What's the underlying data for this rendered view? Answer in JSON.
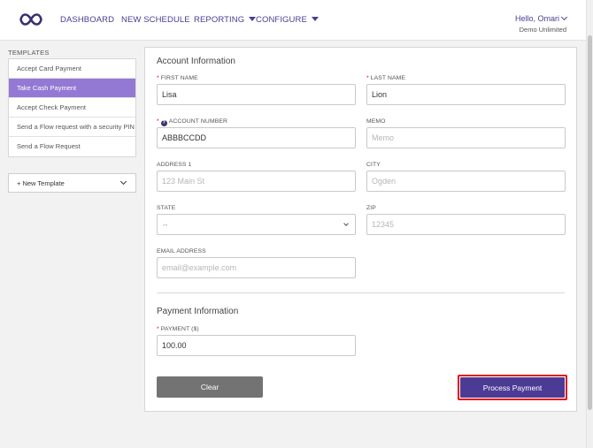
{
  "nav": {
    "items": [
      {
        "label": "DASHBOARD"
      },
      {
        "label": "NEW SCHEDULE"
      },
      {
        "label": "REPORTING"
      },
      {
        "label": "CONFIGURE"
      }
    ],
    "user_greeting": "Hello, Omari",
    "organization": "Demo Unlimited",
    "logo_icon": "infinity-logo-icon",
    "brand_color": "#4a3d8f"
  },
  "sidebar": {
    "heading": "TEMPLATES",
    "items": [
      {
        "label": "Accept Card Payment",
        "active": false
      },
      {
        "label": "Take Cash Payment",
        "active": true
      },
      {
        "label": "Accept Check Payment",
        "active": false
      },
      {
        "label": "Send a Flow request with a security PIN",
        "active": false
      },
      {
        "label": "Send a Flow Request",
        "active": false
      }
    ],
    "new_template_label": "+ New Template",
    "active_color": "#9479d4"
  },
  "form": {
    "account_section_title": "Account Information",
    "first_name": {
      "label": "FIRST NAME",
      "value": "Lisa",
      "required": true
    },
    "last_name": {
      "label": "LAST NAME",
      "value": "Lion",
      "required": true
    },
    "account_number": {
      "label": "ACCOUNT NUMBER",
      "value": "ABBBCCDD",
      "required": true
    },
    "memo": {
      "label": "MEMO",
      "value": "",
      "placeholder": "Memo"
    },
    "address1": {
      "label": "ADDRESS 1",
      "value": "",
      "placeholder": "123 Main St"
    },
    "city": {
      "label": "CITY",
      "value": "",
      "placeholder": "Ogden"
    },
    "state": {
      "label": "STATE",
      "selected": "--"
    },
    "zip": {
      "label": "ZIP",
      "value": "",
      "placeholder": "12345"
    },
    "email": {
      "label": "EMAIL ADDRESS",
      "value": "",
      "placeholder": "email@example.com"
    },
    "payment_section_title": "Payment Information",
    "payment": {
      "label": "PAYMENT ($)",
      "value": "100.00",
      "required": true
    },
    "required_marker": "*",
    "info_marker": "?",
    "clear_label": "Clear",
    "process_label": "Process Payment",
    "process_color": "#4c3b95",
    "highlight_color": "#e0121b"
  }
}
